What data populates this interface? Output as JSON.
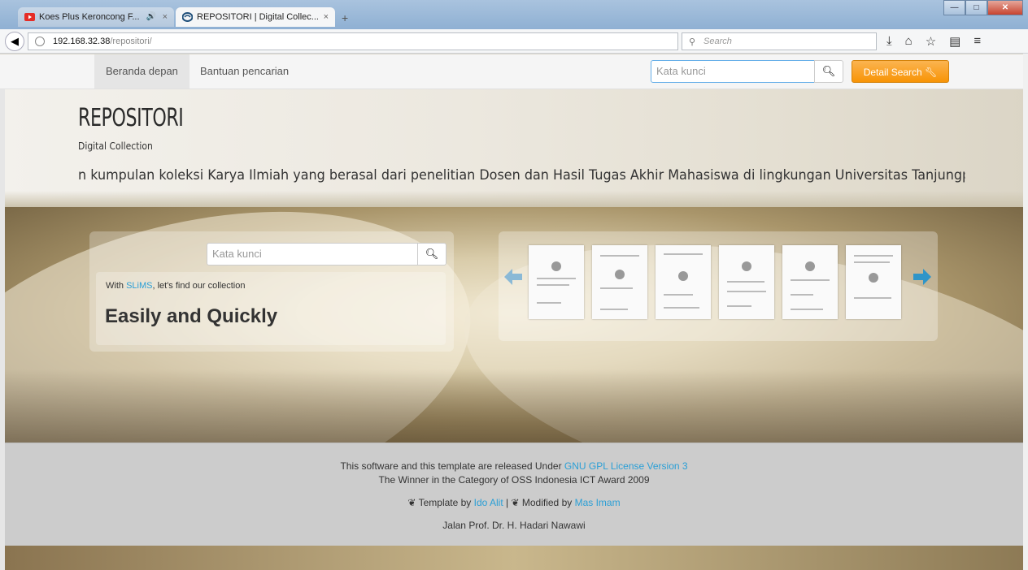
{
  "browser": {
    "tabs": [
      {
        "title": "Koes Plus Keroncong F...",
        "icon": "youtube-icon",
        "audio": "🔊",
        "close": "×"
      },
      {
        "title": "REPOSITORI | Digital Collec...",
        "icon": "slims-icon",
        "close": "×"
      }
    ],
    "new_tab": "+",
    "url_host": "192.168.32.38",
    "url_path": "/repositori/",
    "search_placeholder": "Search",
    "reload": "C",
    "toolbar_icons": [
      "download-icon",
      "home-icon",
      "bookmark-star-icon",
      "bookmarks-list-icon",
      "menu-icon"
    ]
  },
  "site_nav": {
    "home": "Beranda depan",
    "help": "Bantuan pencarian",
    "search_placeholder": "Kata kunci",
    "detail_search": "Detail Search"
  },
  "header": {
    "title": "REPOSITORI",
    "subtitle": "Digital Collection",
    "marquee": "n kumpulan koleksi Karya Ilmiah yang berasal dari penelitian Dosen dan Hasil Tugas Akhir Mahasiswa di lingkungan Universitas Tanjungpura P"
  },
  "hero": {
    "search_placeholder": "Kata kunci",
    "tag_prefix": "With ",
    "tag_link": "SLiMS",
    "tag_suffix": ", let's find our collection",
    "tag_big": "Easily and Quickly"
  },
  "footer": {
    "line1_prefix": "This software and this template are released Under ",
    "line1_link": "GNU GPL License Version 3",
    "line2": "The Winner in the Category of OSS Indonesia ICT Award 2009",
    "template_by": "Template by ",
    "template_author": "Ido Alit",
    "sep": " | ",
    "modified_by": "Modified by ",
    "modified_author": "Mas Imam",
    "address": "Jalan Prof. Dr. H. Hadari Nawawi"
  },
  "colors": {
    "accent": "#2a9fd6",
    "detail_button": "#f89406"
  }
}
